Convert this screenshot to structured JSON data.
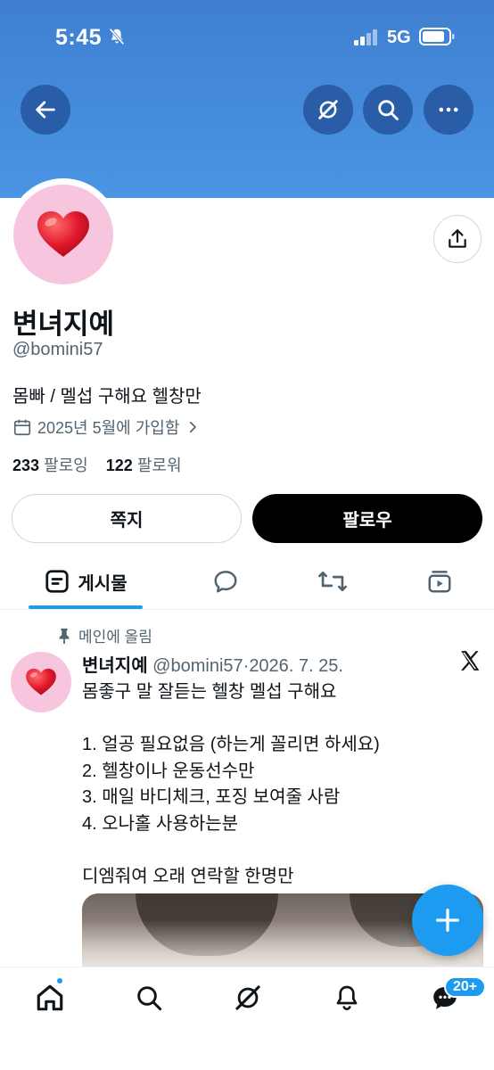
{
  "status_bar": {
    "time": "5:45",
    "network": "5G"
  },
  "profile": {
    "display_name": "변녀지예",
    "handle": "@bomini57",
    "bio": "몸빠 / 멜섭 구해요 헬창만",
    "joined": "2025년 5월에 가입함",
    "following_count": "233",
    "following_label": "팔로잉",
    "followers_count": "122",
    "followers_label": "팔로워",
    "avatar_emoji": "❤️"
  },
  "actions": {
    "message_label": "쪽지",
    "follow_label": "팔로우"
  },
  "tabs": {
    "posts_label": "게시물"
  },
  "post": {
    "pinned_label": "메인에 올림",
    "author_name": "변녀지예",
    "author_handle": "@bomini57",
    "separator": "·",
    "date": "2026. 7. 25.",
    "lines": [
      "몸좋구 말 잘듣는 헬창 멜섭 구해요",
      "",
      "1. 얼공 필요없음 (하는게 꼴리면 하세요)",
      "2. 헬창이나 운동선수만",
      "3. 매일 바디체크, 포징 보여줄 사람",
      "4. 오나홀 사용하는분",
      "",
      "디엠줘여 오래 연락할 한명만"
    ]
  },
  "bottom_nav": {
    "messages_badge": "20+"
  },
  "colors": {
    "accent": "#1d9bf0",
    "banner": "#4a95e4",
    "button_dark": "#2a5da8"
  }
}
